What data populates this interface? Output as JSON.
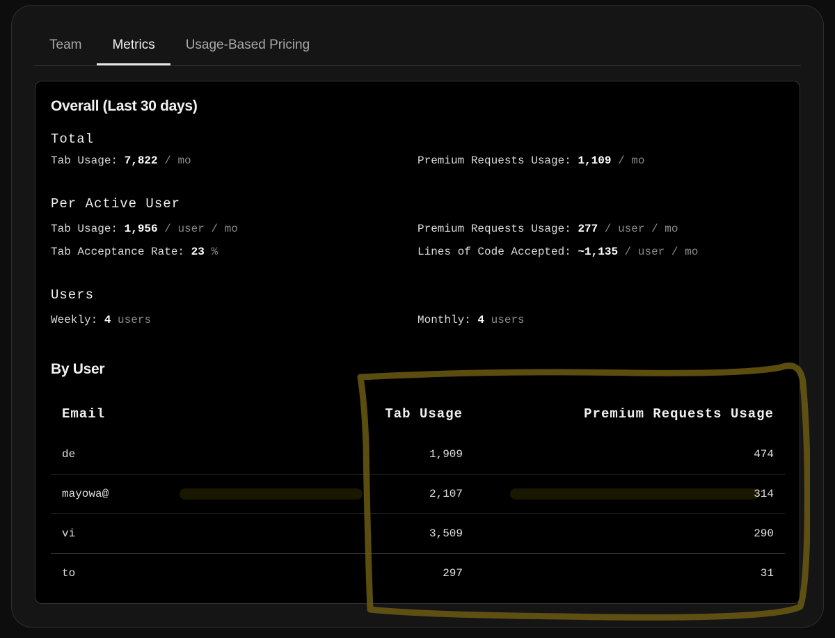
{
  "tabs": [
    {
      "label": "Team"
    },
    {
      "label": "Metrics"
    },
    {
      "label": "Usage-Based Pricing"
    }
  ],
  "overall": {
    "title": "Overall (Last 30 days)",
    "total": {
      "heading": "Total",
      "tab_usage": {
        "label": "Tab Usage:",
        "value": "7,822",
        "unit": "/ mo"
      },
      "premium_usage": {
        "label": "Premium Requests Usage:",
        "value": "1,109",
        "unit": "/ mo"
      }
    },
    "per_active_user": {
      "heading": "Per Active User",
      "tab_usage": {
        "label": "Tab Usage:",
        "value": "1,956",
        "unit": "/ user / mo"
      },
      "premium_usage": {
        "label": "Premium Requests Usage:",
        "value": "277",
        "unit": "/ user / mo"
      },
      "acceptance_rate": {
        "label": "Tab Acceptance Rate:",
        "value": "23",
        "unit": "%"
      },
      "lines_accepted": {
        "label": "Lines of Code Accepted:",
        "value": "~1,135",
        "unit": "/ user / mo"
      }
    },
    "users": {
      "heading": "Users",
      "weekly": {
        "label": "Weekly:",
        "value": "4",
        "unit": "users"
      },
      "monthly": {
        "label": "Monthly:",
        "value": "4",
        "unit": "users"
      }
    }
  },
  "by_user": {
    "title": "By User",
    "columns": [
      "Email",
      "Tab Usage",
      "Premium Requests Usage"
    ],
    "rows": [
      {
        "email": "de",
        "tab": "1,909",
        "premium": "474"
      },
      {
        "email": "mayowa@",
        "tab": "2,107",
        "premium": "314"
      },
      {
        "email": "vi",
        "tab": "3,509",
        "premium": "290"
      },
      {
        "email": "to",
        "tab": "297",
        "premium": "31"
      }
    ]
  },
  "colors": {
    "background": "#000000",
    "highlight": "#6b5a12"
  }
}
